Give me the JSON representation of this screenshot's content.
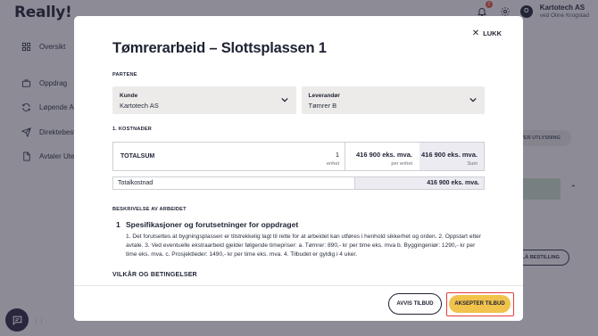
{
  "app": {
    "logo": "Really!",
    "notifications_count": "2",
    "company_name": "Kartotech AS",
    "company_user": "ved Oline Krogstad",
    "avatar_initial": "O"
  },
  "sidebar": {
    "items": [
      {
        "label": "Oversikt",
        "icon": "grid-icon"
      },
      {
        "label": "Oppdrag",
        "icon": "briefcase-icon"
      },
      {
        "label": "Løpende Av",
        "icon": "refresh-icon"
      },
      {
        "label": "Direktebest",
        "icon": "send-icon"
      },
      {
        "label": "Avtaler Uten",
        "icon": "document-icon"
      }
    ]
  },
  "background": {
    "pill_label": "VER UTLYSNING",
    "green_label": "gitt",
    "button_label": "LÅ BESTILLING"
  },
  "modal": {
    "title": "Tømrerarbeid – Slottsplassen 1",
    "close_label": "LUKK",
    "parties": {
      "section_label": "PARTENE",
      "customer_label": "Kunde",
      "customer_value": "Kartotech AS",
      "supplier_label": "Leverandør",
      "supplier_value": "Tømrer B"
    },
    "costs": {
      "section_label": "1. KOSTNADER",
      "row_label": "TOTALSUM",
      "quantity": "1",
      "quantity_unit": "enhet",
      "unit_price": "416 900 eks. mva.",
      "unit_price_sub": "per enhet",
      "sum": "416 900 eks. mva.",
      "sum_sub": "Sum",
      "total_label": "Totalkostnad",
      "total_value": "416 900 eks. mva."
    },
    "description": {
      "section_label": "BESKRIVELSE AV ARBEIDET",
      "item_number": "1",
      "item_title": "Spesifikasjoner og forutsetninger for oppdraget",
      "item_text": "1. Det forutsettes at bygningsplassen er tilstrekkelig lagt til rette for at arbeidet kan utføres i henhold sikkerhet og orden. 2. Oppstart etter avtale. 3. Ved eventuelle ekstraarbeid gjelder følgende timepriser: a. Tømrer: 890,- kr per time eks. mva b. Byggingeniør: 1290,- kr per time eks. mva. c. Prosjektleder: 1490,- kr per time eks. mva. 4. Tilbudet er gyldig i 4 uker."
    },
    "terms_label": "VILKÅR OG BETINGELSER",
    "reject_label": "AVVIS TILBUD",
    "accept_label": "AKSEPTER TILBUD"
  }
}
